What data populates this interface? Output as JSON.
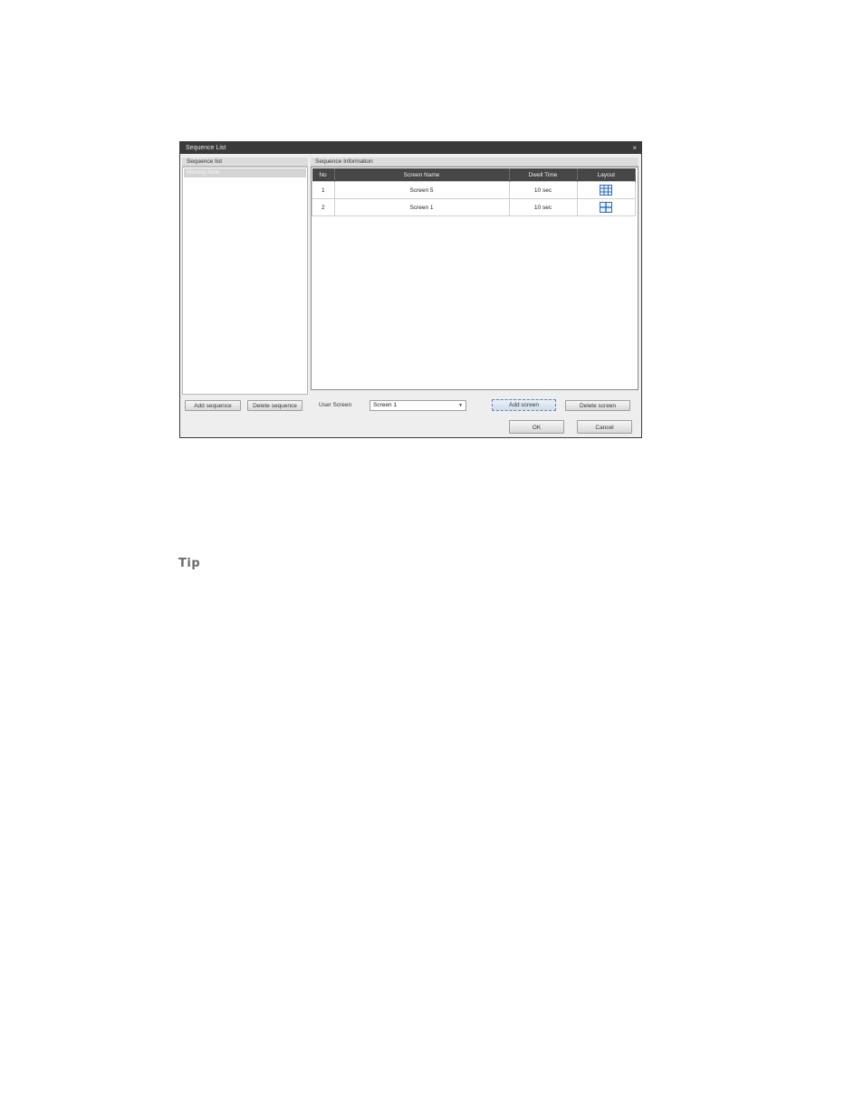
{
  "dialog": {
    "title": "Sequence List",
    "close_glyph": "×",
    "left_panel": {
      "header": "Sequence list",
      "items": [
        {
          "label": "Moving Scre"
        }
      ],
      "add_button": "Add sequence",
      "delete_button": "Delete sequence"
    },
    "right_panel": {
      "header": "Sequence Information",
      "columns": [
        "No",
        "Screen Name",
        "Dwell Time",
        "Layout"
      ],
      "rows": [
        {
          "no": "1",
          "screen_name": "Screen 5",
          "dwell_time": "10 sec",
          "layout_icon": "grid-3x3-icon"
        },
        {
          "no": "2",
          "screen_name": "Screen 1",
          "dwell_time": "10 sec",
          "layout_icon": "grid-2x2-icon"
        }
      ],
      "user_screen_label": "User Screen",
      "user_screen_value": "Screen 1",
      "add_screen_button": "Add screen",
      "delete_screen_button": "Delete screen"
    },
    "ok_button": "OK",
    "cancel_button": "Cancel"
  },
  "tip_label": "Tip",
  "colors": {
    "titlebar": "#3a3a3a",
    "table_header": "#464646",
    "layout_icon": "#2f6db5"
  }
}
